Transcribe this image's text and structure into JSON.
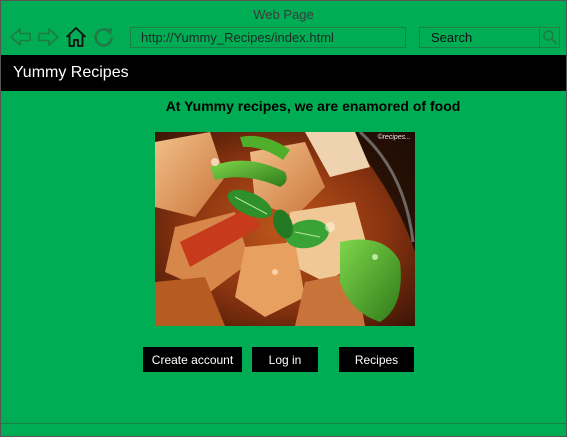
{
  "window": {
    "title": "Web Page"
  },
  "browser": {
    "url": "http://Yummy_Recipes/index.html",
    "search_label": "Search",
    "icons": {
      "back": "back-arrow-icon",
      "forward": "forward-arrow-icon",
      "home": "home-icon",
      "refresh": "refresh-icon",
      "search": "magnifier-icon"
    }
  },
  "header": {
    "site_title": "Yummy Recipes"
  },
  "main": {
    "tagline": "At Yummy recipes, we are enamored of food",
    "image_watermark": "©recipes..."
  },
  "actions": {
    "create_account": "Create account",
    "log_in": "Log in",
    "recipes": "Recipes"
  },
  "colors": {
    "page_background": "#00ad55",
    "header_background": "#000000",
    "button_background": "#000000",
    "button_text": "#ffffff"
  }
}
